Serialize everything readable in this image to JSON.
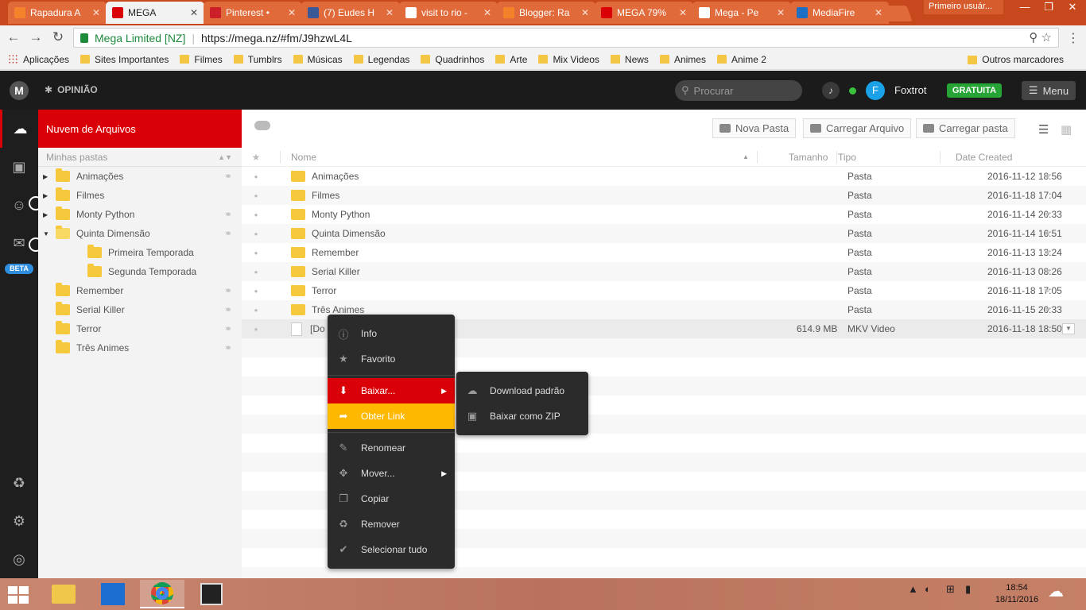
{
  "browser": {
    "tabs": [
      {
        "label": "Rapadura A",
        "color": "#f4822a"
      },
      {
        "label": "MEGA",
        "color": "#d90007",
        "active": true
      },
      {
        "label": "Pinterest •",
        "color": "#cb2027"
      },
      {
        "label": "(7) Eudes H",
        "color": "#3b5998"
      },
      {
        "label": "visit to rio -",
        "color": "#ffffff"
      },
      {
        "label": "Blogger: Ra",
        "color": "#f4822a"
      },
      {
        "label": "MEGA 79%",
        "color": "#d90007"
      },
      {
        "label": "Mega - Pe",
        "color": "#ffffff"
      },
      {
        "label": "MediaFire",
        "color": "#1f6fc5"
      }
    ],
    "profile": "Primeiro usuár...",
    "win_controls": {
      "minimize": "—",
      "maximize": "❐",
      "close": "✕"
    },
    "nav": {
      "back": "←",
      "forward": "→",
      "reload": "↻"
    },
    "secure_label": "Mega Limited [NZ]",
    "url": "https://mega.nz/#fm/J9hzwL4L",
    "omni_icons": "⚲ ☆",
    "menu_icon": "⋮",
    "bookmarks": [
      "Aplicações",
      "Sites Importantes",
      "Filmes",
      "Tumblrs",
      "Músicas",
      "Legendas",
      "Quadrinhos",
      "Arte",
      "Mix Videos",
      "News",
      "Animes",
      "Anime 2"
    ],
    "other_bookmarks": "Outros marcadores"
  },
  "mega": {
    "logo": "M",
    "feedback": "OPINIÃO",
    "search_placeholder": "Procurar",
    "user": {
      "initial": "F",
      "name": "Foxtrot"
    },
    "plan": "GRATUITA",
    "menu_label": "Menu",
    "beta": "BETA",
    "tree": {
      "title": "Nuvem de Arquivos",
      "subheader": "Minhas pastas",
      "items": [
        {
          "label": "Animações",
          "arrow": "▶",
          "level": 0,
          "link": true
        },
        {
          "label": "Filmes",
          "arrow": "▶",
          "level": 0,
          "link": false
        },
        {
          "label": "Monty Python",
          "arrow": "▶",
          "level": 0,
          "link": true
        },
        {
          "label": "Quinta Dimensão",
          "arrow": "▼",
          "level": 0,
          "link": true
        },
        {
          "label": "Primeira Temporada",
          "arrow": "",
          "level": 1,
          "link": false
        },
        {
          "label": "Segunda Temporada",
          "arrow": "",
          "level": 1,
          "link": false
        },
        {
          "label": "Remember",
          "arrow": "",
          "level": 0,
          "link": true
        },
        {
          "label": "Serial Killer",
          "arrow": "",
          "level": 0,
          "link": true
        },
        {
          "label": "Terror",
          "arrow": "",
          "level": 0,
          "link": true
        },
        {
          "label": "Três Animes",
          "arrow": "",
          "level": 0,
          "link": true
        }
      ]
    },
    "toolbar": {
      "new_folder": "Nova Pasta",
      "upload_file": "Carregar Arquivo",
      "upload_folder": "Carregar pasta"
    },
    "columns": {
      "star": "★",
      "name": "Nome",
      "size": "Tamanho",
      "type": "Tipo",
      "date": "Date Created"
    },
    "files": [
      {
        "name": "Animações",
        "size": "",
        "type": "Pasta",
        "date": "2016-11-12 18:56",
        "kind": "folder",
        "link": true
      },
      {
        "name": "Filmes",
        "size": "",
        "type": "Pasta",
        "date": "2016-11-18 17:04",
        "kind": "folder",
        "link": false
      },
      {
        "name": "Monty Python",
        "size": "",
        "type": "Pasta",
        "date": "2016-11-14 20:33",
        "kind": "folder",
        "link": true
      },
      {
        "name": "Quinta Dimensão",
        "size": "",
        "type": "Pasta",
        "date": "2016-11-14 16:51",
        "kind": "folder",
        "link": true
      },
      {
        "name": "Remember",
        "size": "",
        "type": "Pasta",
        "date": "2016-11-13 13:24",
        "kind": "folder",
        "link": true
      },
      {
        "name": "Serial Killer",
        "size": "",
        "type": "Pasta",
        "date": "2016-11-13 08:26",
        "kind": "folder",
        "link": true
      },
      {
        "name": "Terror",
        "size": "",
        "type": "Pasta",
        "date": "2016-11-18 17:05",
        "kind": "folder",
        "link": true
      },
      {
        "name": "Três Animes",
        "size": "",
        "type": "Pasta",
        "date": "2016-11-15 20:33",
        "kind": "folder",
        "link": true
      },
      {
        "name": "[Do                                              en no Natsuyasumi.mkv",
        "size": "614.9 MB",
        "type": "MKV Video",
        "date": "2016-11-18 18:50",
        "kind": "file",
        "link": false,
        "selected": true
      }
    ],
    "context_menu": {
      "info": "Info",
      "favorite": "Favorito",
      "download": "Baixar...",
      "get_link": "Obter Link",
      "rename": "Renomear",
      "move": "Mover...",
      "copy": "Copiar",
      "remove": "Remover",
      "select_all": "Selecionar tudo"
    },
    "download_submenu": {
      "standard": "Download padrão",
      "zip": "Baixar como ZIP"
    }
  },
  "taskbar": {
    "time": "18:54",
    "date": "18/11/2016"
  }
}
